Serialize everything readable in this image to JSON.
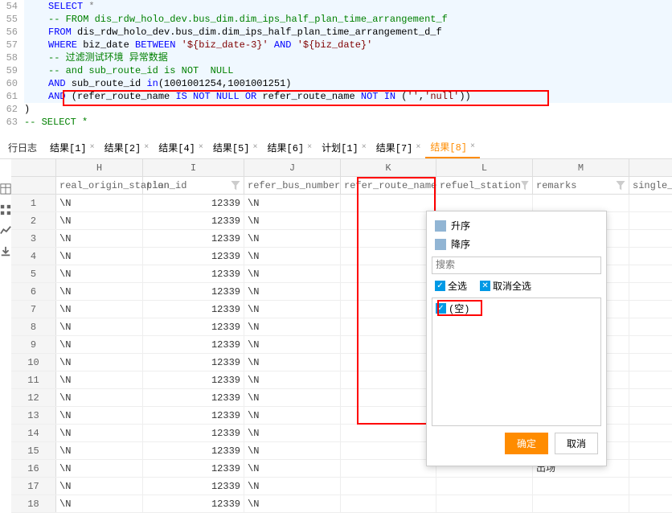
{
  "editor": {
    "lines": [
      {
        "n": 54,
        "html": "<span class='kw'>SELECT</span> <span class='op'>*</span>"
      },
      {
        "n": 55,
        "html": "<span class='cm'>-- FROM dis_rdw_holo_dev.bus_dim.dim_ips_half_plan_time_arrangement_f</span>"
      },
      {
        "n": 56,
        "html": "<span class='kw'>FROM</span> dis_rdw_holo_dev.bus_dim.dim_ips_half_plan_time_arrangement_d_f"
      },
      {
        "n": 57,
        "html": "<span class='kw'>WHERE</span> biz_date <span class='kw'>BETWEEN</span> <span class='str'>'${biz_date-3}'</span> <span class='kw'>AND</span> <span class='str'>'${biz_date}'</span>"
      },
      {
        "n": 58,
        "html": "<span class='cm'>-- 过滤测试环境 异常数据</span>"
      },
      {
        "n": 59,
        "html": "<span class='cm'>-- and sub_route_id is NOT  NULL</span>"
      },
      {
        "n": 60,
        "html": "<span class='kw'>AND</span> sub_route_id <span class='kw'>in</span>(<span class='num'>1001001254</span>,<span class='num'>1001001251</span>)"
      },
      {
        "n": 61,
        "html": "<span class='kw'>AND</span> (refer_route_name <span class='kw'>IS NOT NULL OR</span> refer_route_name <span class='kw'>NOT IN</span> (<span class='str'>''</span>,<span class='str'>'null'</span>))"
      },
      {
        "n": 62,
        "html": ")",
        "bg": "#fff"
      },
      {
        "n": 63,
        "html": "<span class='cm'>-- SELECT *</span>",
        "bg": "#fff"
      }
    ]
  },
  "tabs": {
    "log": "行日志",
    "items": [
      {
        "label": "结果[1]"
      },
      {
        "label": "结果[2]"
      },
      {
        "label": "结果[4]"
      },
      {
        "label": "结果[5]"
      },
      {
        "label": "结果[6]"
      },
      {
        "label": "计划[1]"
      },
      {
        "label": "结果[7]"
      },
      {
        "label": "结果[8]",
        "active": true
      }
    ]
  },
  "grid": {
    "colLetters": [
      "H",
      "I",
      "J",
      "K",
      "L",
      "M"
    ],
    "fields": [
      "real_origin_station",
      "plan_id",
      "refer_bus_number",
      "refer_route_name",
      "refuel_station",
      "remarks",
      "single_trip"
    ],
    "rows": [
      {
        "n": 1,
        "h": "\\N",
        "i": "12339",
        "j": "\\N",
        "k": "",
        "l": "",
        "m": ""
      },
      {
        "n": 2,
        "h": "\\N",
        "i": "12339",
        "j": "\\N",
        "k": "",
        "l": "",
        "m": ""
      },
      {
        "n": 3,
        "h": "\\N",
        "i": "12339",
        "j": "\\N",
        "k": "",
        "l": "",
        "m": ""
      },
      {
        "n": 4,
        "h": "\\N",
        "i": "12339",
        "j": "\\N",
        "k": "",
        "l": "",
        "m": ""
      },
      {
        "n": 5,
        "h": "\\N",
        "i": "12339",
        "j": "\\N",
        "k": "",
        "l": "",
        "m": ""
      },
      {
        "n": 6,
        "h": "\\N",
        "i": "12339",
        "j": "\\N",
        "k": "",
        "l": "",
        "m": ""
      },
      {
        "n": 7,
        "h": "\\N",
        "i": "12339",
        "j": "\\N",
        "k": "",
        "l": "",
        "m": ""
      },
      {
        "n": 8,
        "h": "\\N",
        "i": "12339",
        "j": "\\N",
        "k": "",
        "l": "",
        "m": ""
      },
      {
        "n": 9,
        "h": "\\N",
        "i": "12339",
        "j": "\\N",
        "k": "",
        "l": "",
        "m": ""
      },
      {
        "n": 10,
        "h": "\\N",
        "i": "12339",
        "j": "\\N",
        "k": "",
        "l": "",
        "m": ""
      },
      {
        "n": 11,
        "h": "\\N",
        "i": "12339",
        "j": "\\N",
        "k": "",
        "l": "",
        "m": ""
      },
      {
        "n": 12,
        "h": "\\N",
        "i": "12339",
        "j": "\\N",
        "k": "",
        "l": "",
        "m": ""
      },
      {
        "n": 13,
        "h": "\\N",
        "i": "12339",
        "j": "\\N",
        "k": "",
        "l": "",
        "m": ""
      },
      {
        "n": 14,
        "h": "\\N",
        "i": "12339",
        "j": "\\N",
        "k": "",
        "l": "",
        "m": ""
      },
      {
        "n": 15,
        "h": "\\N",
        "i": "12339",
        "j": "\\N",
        "k": "",
        "l": "",
        "m": ""
      },
      {
        "n": 16,
        "h": "\\N",
        "i": "12339",
        "j": "\\N",
        "k": "",
        "l": "",
        "m": "出场"
      },
      {
        "n": 17,
        "h": "\\N",
        "i": "12339",
        "j": "\\N",
        "k": "",
        "l": "",
        "m": ""
      },
      {
        "n": 18,
        "h": "\\N",
        "i": "12339",
        "j": "\\N",
        "k": "",
        "l": "",
        "m": ""
      }
    ]
  },
  "filter": {
    "asc": "升序",
    "desc": "降序",
    "searchPlaceholder": "搜索",
    "selectAll": "全选",
    "deselectAll": "取消全选",
    "empty": "(空)",
    "ok": "确定",
    "cancel": "取消"
  }
}
